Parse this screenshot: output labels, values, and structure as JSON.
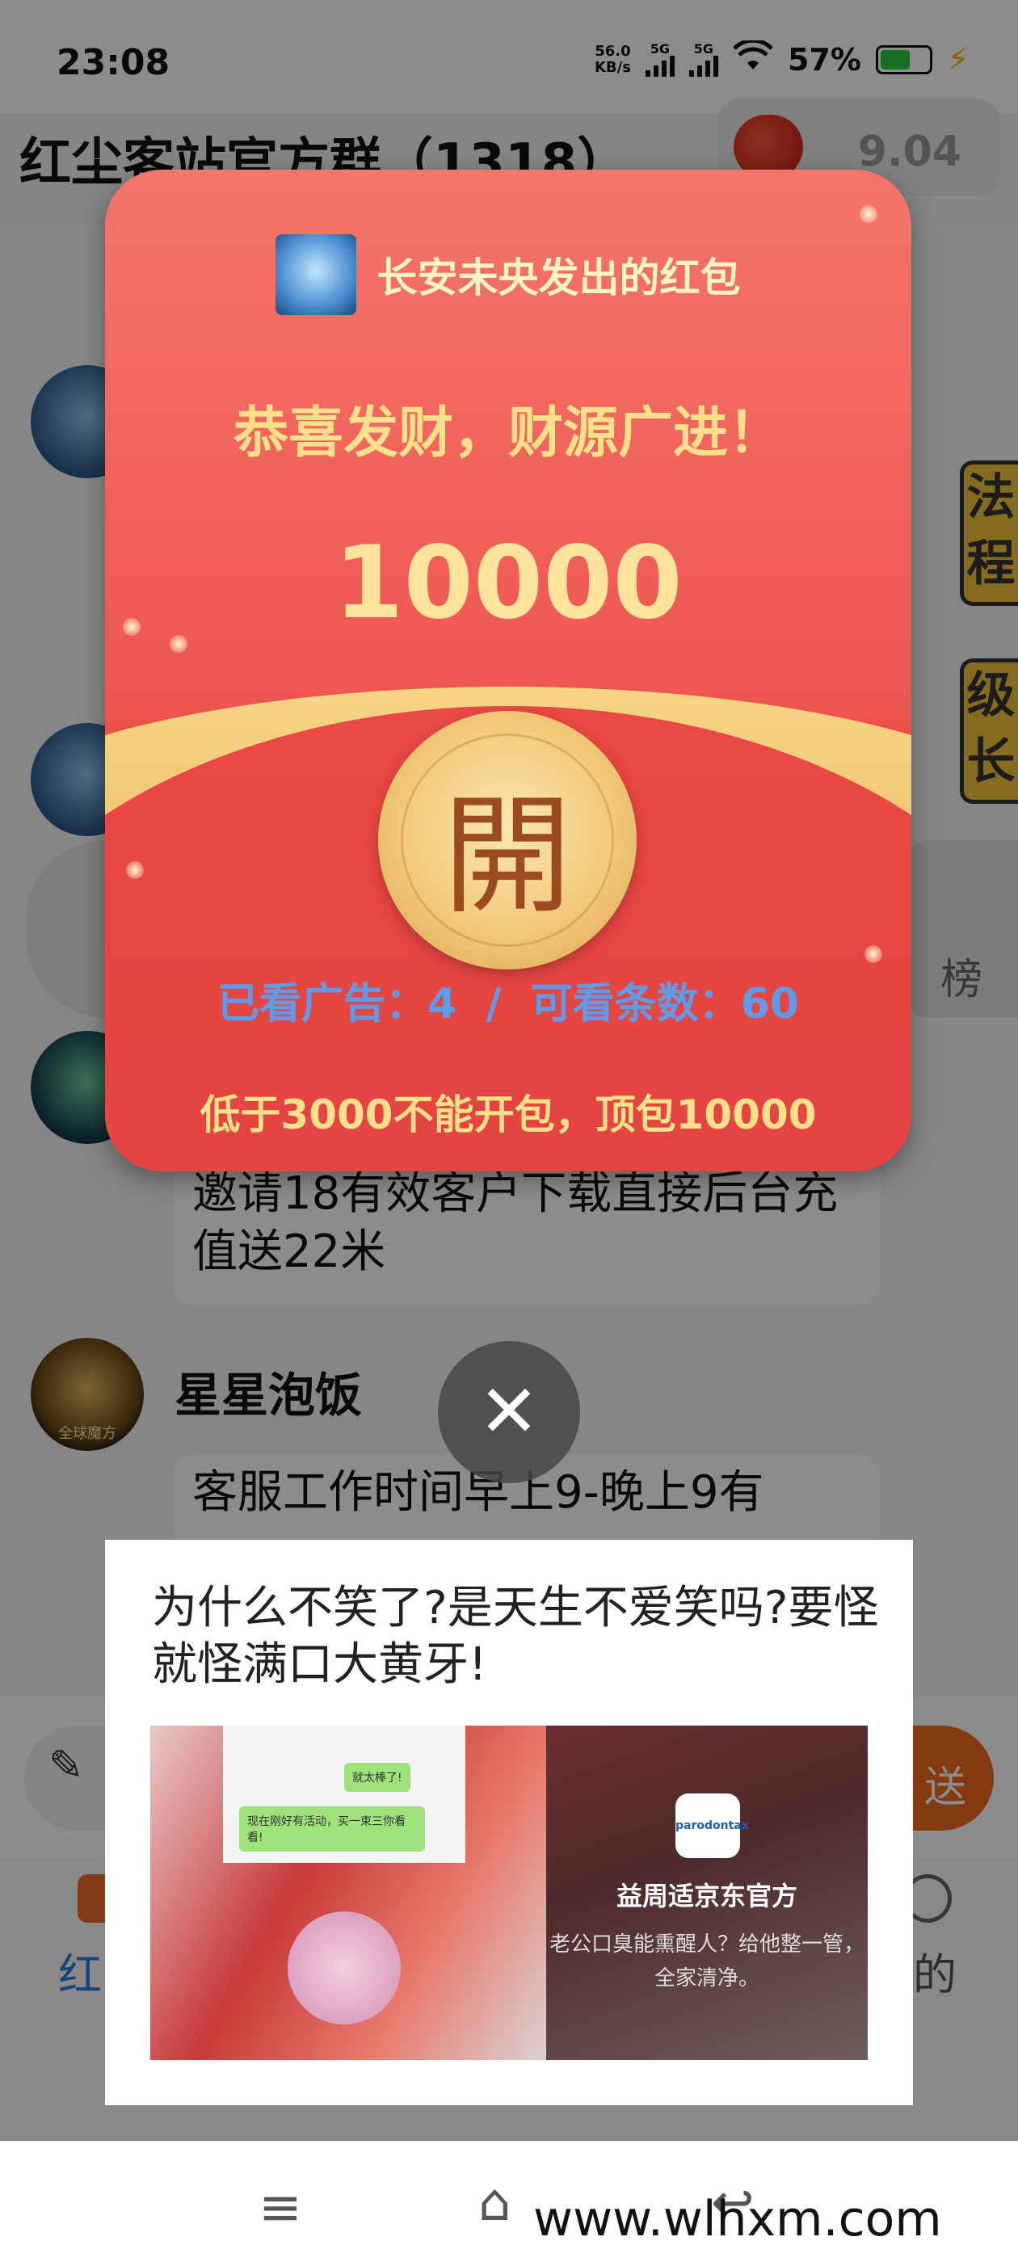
{
  "status_bar": {
    "time": "23:08",
    "net_speed": "56.0\nKB/s",
    "signal_1": "5G",
    "signal_2": "5G",
    "battery": "57%"
  },
  "header": {
    "title": "红尘客站官方群（1318）",
    "balance": "9.04"
  },
  "chat": {
    "side_deco_1": "法\n程",
    "side_deco_2": "级\n长",
    "side_pill_label": "榜",
    "bubble_1": "邀请18有效客户下载直接后台充值送22米",
    "sender_2": "星星泡饭",
    "avatar_2_caption": "全球魔方",
    "bubble_2": "客服工作时间早上9-晚上9有"
  },
  "input_bar": {
    "send_label": "送"
  },
  "tabbar": {
    "tab_red_label": "红",
    "tab_me_label": "的"
  },
  "red_packet": {
    "sender_text": "长安未央发出的红包",
    "blessing": "恭喜发财，财源广进！",
    "amount": "10000",
    "open_char": "開",
    "ad_status": "已看广告：4  /  可看条数：60",
    "rule_text": "低于3000不能开包，顶包10000"
  },
  "close_button": {
    "icon": "✕"
  },
  "ad": {
    "title": "为什么不笑了?是天生不爱笑吗?要怪就怪满口大黄牙!",
    "chat_msg_1": "就太棒了!",
    "chat_msg_2": "现在刚好有活动，买一束三你看看!",
    "brand_logo_text": "parodontax",
    "brand_name": "益周适京东官方",
    "brand_slogan": "老公口臭能熏醒人？给他整一管，全家清净。"
  },
  "navbar": {
    "menu_icon": "≡",
    "home_icon": "⌂",
    "back_icon": "↩"
  },
  "watermark": "www.wlhxm.com",
  "colors": {
    "packet_red": "#ee5550",
    "packet_gold": "#ffe08a",
    "ad_status_blue": "#5f9be8",
    "send_orange": "#f06a1a"
  }
}
